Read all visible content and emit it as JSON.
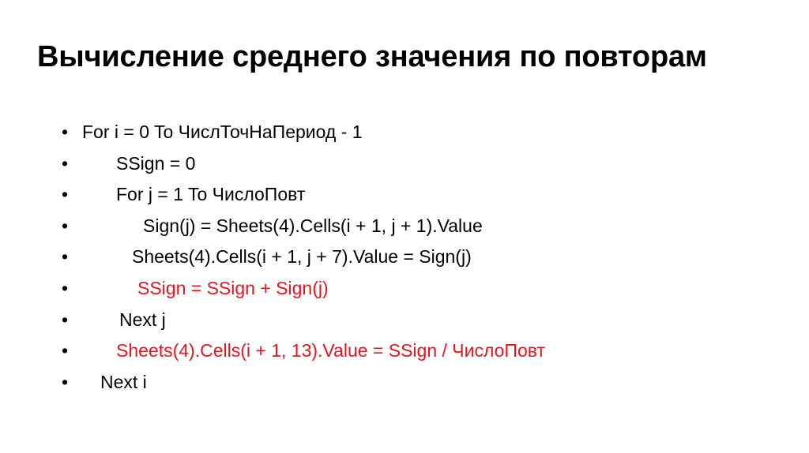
{
  "slide": {
    "title": "Вычисление среднего значения по повторам",
    "background_color": "#ffffff",
    "text_color": "#000000",
    "highlight_color": "#e8141e",
    "bullet_glyph": "•",
    "lines": [
      {
        "text": "For i = 0 To ЧислТочНаПериод - 1",
        "color": "#000000",
        "indent": 0
      },
      {
        "text": "SSign = 0",
        "color": "#000000",
        "indent": 1
      },
      {
        "text": "For j = 1 To ЧислоПовт",
        "color": "#000000",
        "indent": 1
      },
      {
        "text": "Sign(j) = Sheets(4).Cells(i + 1, j + 1).Value",
        "color": "#000000",
        "indent": 2
      },
      {
        "text": "Sheets(4).Cells(i + 1, j + 7).Value = Sign(j)",
        "color": "#000000",
        "indent": 3
      },
      {
        "text": "SSign = SSign + Sign(j)",
        "color": "#e8141e",
        "indent": 4
      },
      {
        "text": "Next j",
        "color": "#000000",
        "indent": 5
      },
      {
        "text": "Sheets(4).Cells(i + 1, 13).Value = SSign / ЧислоПовт",
        "color": "#e8141e",
        "indent": 6
      },
      {
        "text": "Next i",
        "color": "#000000",
        "indent": 7
      }
    ]
  }
}
